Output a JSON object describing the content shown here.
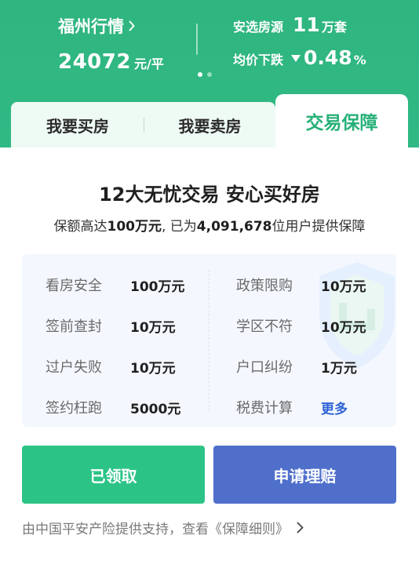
{
  "market": {
    "city": "福州行情",
    "price": "24072",
    "price_unit": "元/平"
  },
  "stats": {
    "listings_label": "安选房源",
    "listings_value": "11",
    "listings_unit": "万套",
    "avg_label": "均价下跌",
    "avg_value": "0.48",
    "avg_unit": "%"
  },
  "carousel": {
    "pages": 2,
    "active": 1
  },
  "tabs": {
    "buy": "我要买房",
    "sell": "我要卖房",
    "guarantee": "交易保障"
  },
  "guarantee": {
    "headline": "12大无忧交易 安心买好房",
    "sub_prefix": "保额高达",
    "sub_amount": "100万元",
    "sub_mid": ", 已为",
    "sub_users": "4,091,678",
    "sub_suffix": "位用户提供保障",
    "items_left": [
      {
        "label": "看房安全",
        "value": "100万元"
      },
      {
        "label": "签前查封",
        "value": "10万元"
      },
      {
        "label": "过户失败",
        "value": "10万元"
      },
      {
        "label": "签约枉跑",
        "value": "5000元"
      }
    ],
    "items_right": [
      {
        "label": "政策限购",
        "value": "10万元"
      },
      {
        "label": "学区不符",
        "value": "10万元"
      },
      {
        "label": "户口纠纷",
        "value": "1万元"
      },
      {
        "label": "税费计算",
        "value": "更多"
      }
    ]
  },
  "buttons": {
    "claimed": "已领取",
    "claim": "申请理赔"
  },
  "footer": {
    "text": "由中国平安产险提供支持，查看《保障细则》"
  },
  "colors": {
    "brand_green": "#2fb57f",
    "tab_active_text": "#27b078",
    "claimed_button": "#2cc486",
    "claim_button": "#4f6fcb",
    "link_blue": "#2f63d6"
  }
}
